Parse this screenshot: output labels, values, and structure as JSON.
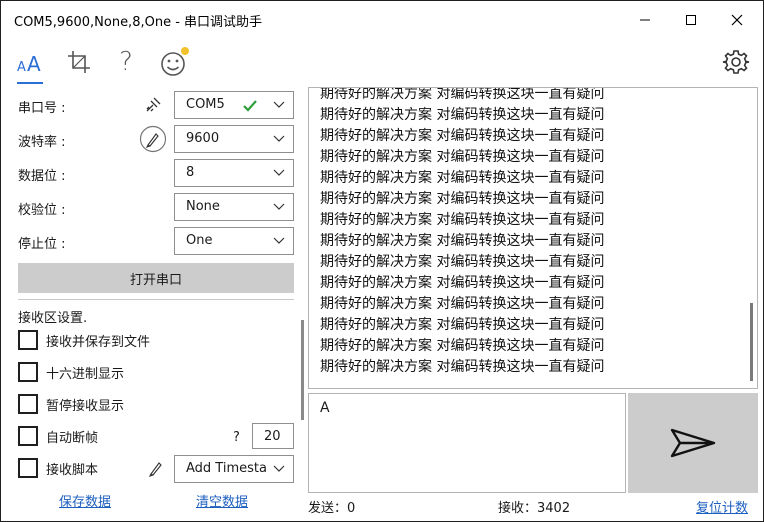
{
  "window": {
    "title": "COM5,9600,None,8,One - 串口调试助手"
  },
  "toolbar": {
    "icons": [
      "font-icon",
      "crop-icon",
      "help-icon",
      "smiley-icon",
      "settings-icon"
    ],
    "help_glyph": "?",
    "accent": "#2a6fd6"
  },
  "settings": {
    "port_label": "串口号 :",
    "port_value": "COM5",
    "baud_label": "波特率 :",
    "baud_value": "9600",
    "databits_label": "数据位 :",
    "databits_value": "8",
    "parity_label": "校验位 :",
    "parity_value": "None",
    "stopbits_label": "停止位 :",
    "stopbits_value": "One",
    "open_button": "打开串口"
  },
  "receive_settings": {
    "heading": "接收区设置.",
    "save_to_file": "接收并保存到文件",
    "hex_display": "十六进制显示",
    "pause_display": "暂停接收显示",
    "auto_frame": "自动断帧",
    "auto_frame_help": "?",
    "auto_frame_value": "20",
    "script_label": "接收脚本",
    "script_value": "Add Timesta",
    "save_data": "保存数据",
    "clear_data": "清空数据"
  },
  "receive_lines": [
    "期待好的解决方案 对编码转换这块一直有疑问",
    "期待好的解决方案 对编码转换这块一直有疑问",
    "期待好的解决方案 对编码转换这块一直有疑问",
    "期待好的解决方案 对编码转换这块一直有疑问",
    "期待好的解决方案 对编码转换这块一直有疑问",
    "期待好的解决方案 对编码转换这块一直有疑问",
    "期待好的解决方案 对编码转换这块一直有疑问",
    "期待好的解决方案 对编码转换这块一直有疑问",
    "期待好的解决方案 对编码转换这块一直有疑问",
    "期待好的解决方案 对编码转换这块一直有疑问",
    "期待好的解决方案 对编码转换这块一直有疑问",
    "期待好的解决方案 对编码转换这块一直有疑问",
    "期待好的解决方案 对编码转换这块一直有疑问",
    "期待好的解决方案 对编码转换这块一直有疑问"
  ],
  "send": {
    "input_value": "A"
  },
  "statusbar": {
    "sent": "发送：0",
    "received": "接收：3402",
    "reset": "复位计数"
  }
}
